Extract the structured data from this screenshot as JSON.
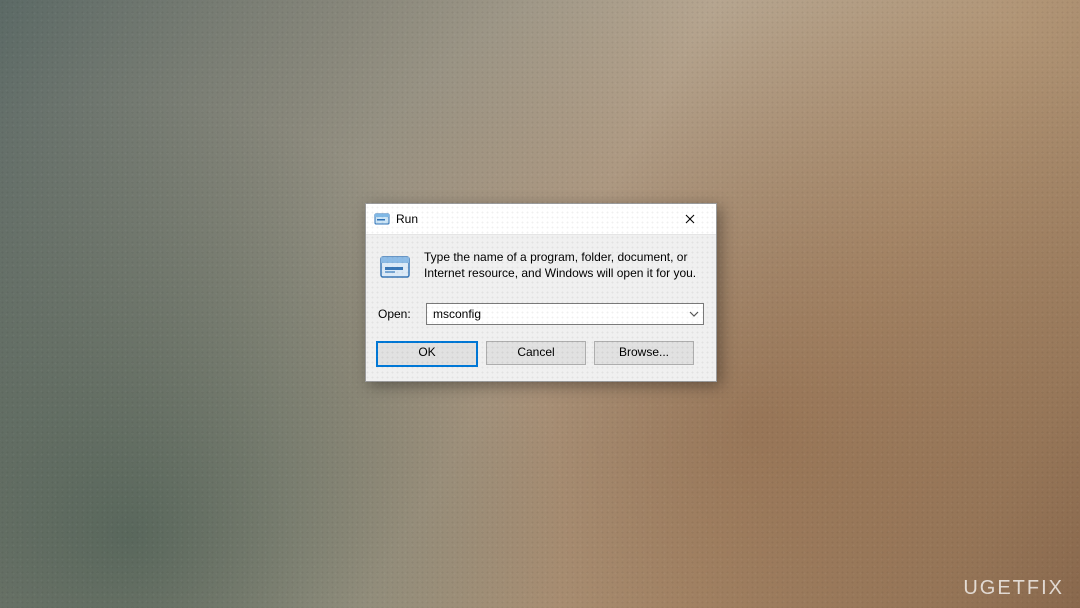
{
  "dialog": {
    "title": "Run",
    "info_text": "Type the name of a program, folder, document, or Internet resource, and Windows will open it for you.",
    "open_label": "Open:",
    "input_value": "msconfig",
    "buttons": {
      "ok": "OK",
      "cancel": "Cancel",
      "browse": "Browse..."
    }
  },
  "watermark": "UGETFIX"
}
